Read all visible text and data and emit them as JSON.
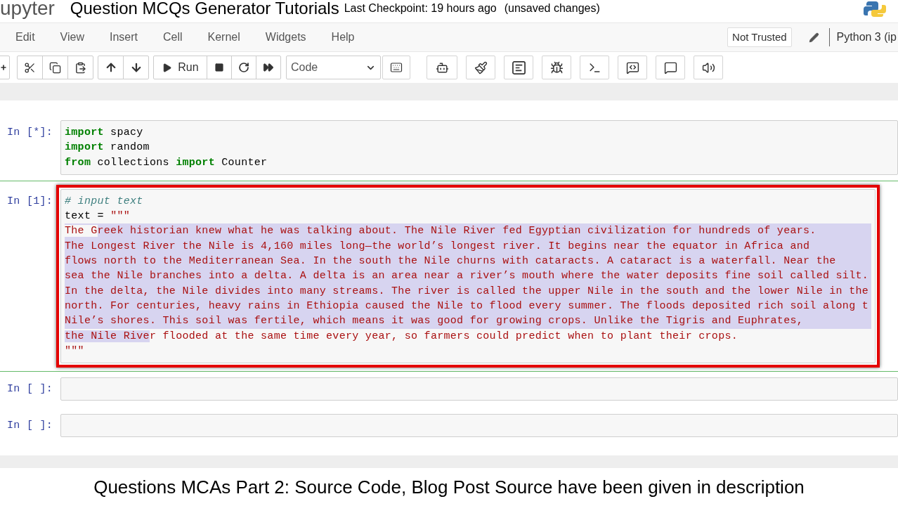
{
  "header": {
    "logo_text": "upyter",
    "title": "Question MCQs Generator Tutorials",
    "checkpoint": "Last Checkpoint: 19 hours ago",
    "save_status": "(unsaved changes)"
  },
  "menu": [
    "Edit",
    "View",
    "Insert",
    "Cell",
    "Kernel",
    "Widgets",
    "Help"
  ],
  "trust_button": "Not Trusted",
  "kernel_name": "Python 3 (ip",
  "toolbar": {
    "run_label": "Run",
    "cell_type": "Code"
  },
  "cells": [
    {
      "prompt": "In [*]:",
      "selected": false,
      "framed": false,
      "lines": [
        {
          "tokens": [
            {
              "kind": "keyword",
              "text": "import"
            },
            {
              "kind": "plain",
              "text": " spacy"
            }
          ]
        },
        {
          "tokens": [
            {
              "kind": "keyword",
              "text": "import"
            },
            {
              "kind": "plain",
              "text": " random"
            }
          ]
        },
        {
          "tokens": [
            {
              "kind": "keyword",
              "text": "from"
            },
            {
              "kind": "plain",
              "text": " collections "
            },
            {
              "kind": "keyword",
              "text": "import"
            },
            {
              "kind": "plain",
              "text": " Counter"
            }
          ]
        }
      ]
    },
    {
      "prompt": "In [1]:",
      "selected": true,
      "framed": true,
      "lines": [
        {
          "tokens": [
            {
              "kind": "comment",
              "text": "# input text",
              "selected": false
            }
          ]
        },
        {
          "tokens": [
            {
              "kind": "plain",
              "text": "text = ",
              "selected": false
            },
            {
              "kind": "string",
              "text": "\"\"\"",
              "selected": false
            }
          ]
        },
        {
          "tokens": [
            {
              "kind": "string",
              "text": "The G",
              "selected": false
            },
            {
              "kind": "string",
              "text": "reek historian knew what he was talking about. The Nile River fed Egyptian civilization for hundreds of years.",
              "selected": true
            }
          ]
        },
        {
          "tokens": [
            {
              "kind": "string",
              "text": "The Longest River the Nile is 4,160 miles long—the world’s longest river. It begins near the equator in Africa and",
              "selected": true
            }
          ]
        },
        {
          "tokens": [
            {
              "kind": "string",
              "text": "flows north to the Mediterranean Sea. In the south the Nile churns with cataracts. A cataract is a waterfall. Near the",
              "selected": true
            }
          ]
        },
        {
          "tokens": [
            {
              "kind": "string",
              "text": "sea the Nile branches into a delta. A delta is an area near a river’s mouth where the water deposits fine soil called silt.",
              "selected": true
            }
          ]
        },
        {
          "tokens": [
            {
              "kind": "string",
              "text": "In the delta, the Nile divides into many streams. The river is called the upper Nile in the south and the lower Nile in the",
              "selected": true
            }
          ]
        },
        {
          "tokens": [
            {
              "kind": "string",
              "text": "north. For centuries, heavy rains in Ethiopia caused the Nile to flood every summer. The floods deposited rich soil along t",
              "selected": true
            }
          ]
        },
        {
          "tokens": [
            {
              "kind": "string",
              "text": "Nile’s shores. This soil was fertile, which means it was good for growing crops. Unlike the Tigris and Euphrates,",
              "selected": true
            }
          ]
        },
        {
          "tokens": [
            {
              "kind": "string",
              "text": "the Nile Rive",
              "selected": true
            },
            {
              "kind": "string",
              "text": "r flooded at the same time every year, so farmers could predict when to plant their crops.",
              "selected": false
            }
          ]
        },
        {
          "tokens": [
            {
              "kind": "string",
              "text": "\"\"\"",
              "selected": false
            }
          ]
        }
      ]
    },
    {
      "prompt": "In [ ]:",
      "selected": false,
      "framed": false
    },
    {
      "prompt": "In [ ]:",
      "selected": false,
      "framed": false
    }
  ],
  "caption": "Questions MCAs Part 2: Source Code, Blog Post Source have been given in description"
}
